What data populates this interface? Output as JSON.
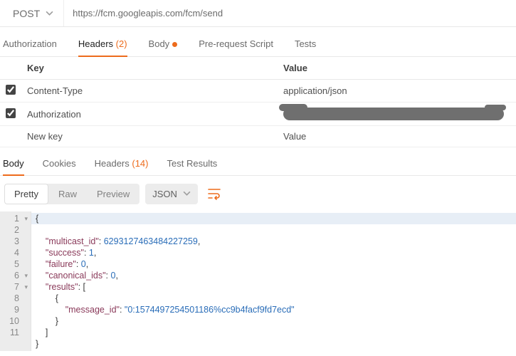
{
  "request": {
    "method": "POST",
    "url": "https://fcm.googleapis.com/fcm/send"
  },
  "req_tabs": {
    "authorization": "Authorization",
    "headers": "Headers",
    "headers_count": "(2)",
    "body": "Body",
    "prerequest": "Pre-request Script",
    "tests": "Tests"
  },
  "headers_table": {
    "col_key": "Key",
    "col_value": "Value",
    "rows": [
      {
        "key": "Content-Type",
        "value": "application/json"
      },
      {
        "key": "Authorization",
        "value": ""
      }
    ],
    "new_key": "New key",
    "new_value": "Value"
  },
  "resp_tabs": {
    "body": "Body",
    "cookies": "Cookies",
    "headers": "Headers",
    "headers_count": "(14)",
    "test_results": "Test Results"
  },
  "format": {
    "pretty": "Pretty",
    "raw": "Raw",
    "preview": "Preview",
    "type": "JSON"
  },
  "response_body": {
    "multicast_id": "6293127463484227259",
    "success": 1,
    "failure": 0,
    "canonical_ids": 0,
    "message_id": "0:1574497254501186%cc9b4facf9fd7ecd"
  }
}
